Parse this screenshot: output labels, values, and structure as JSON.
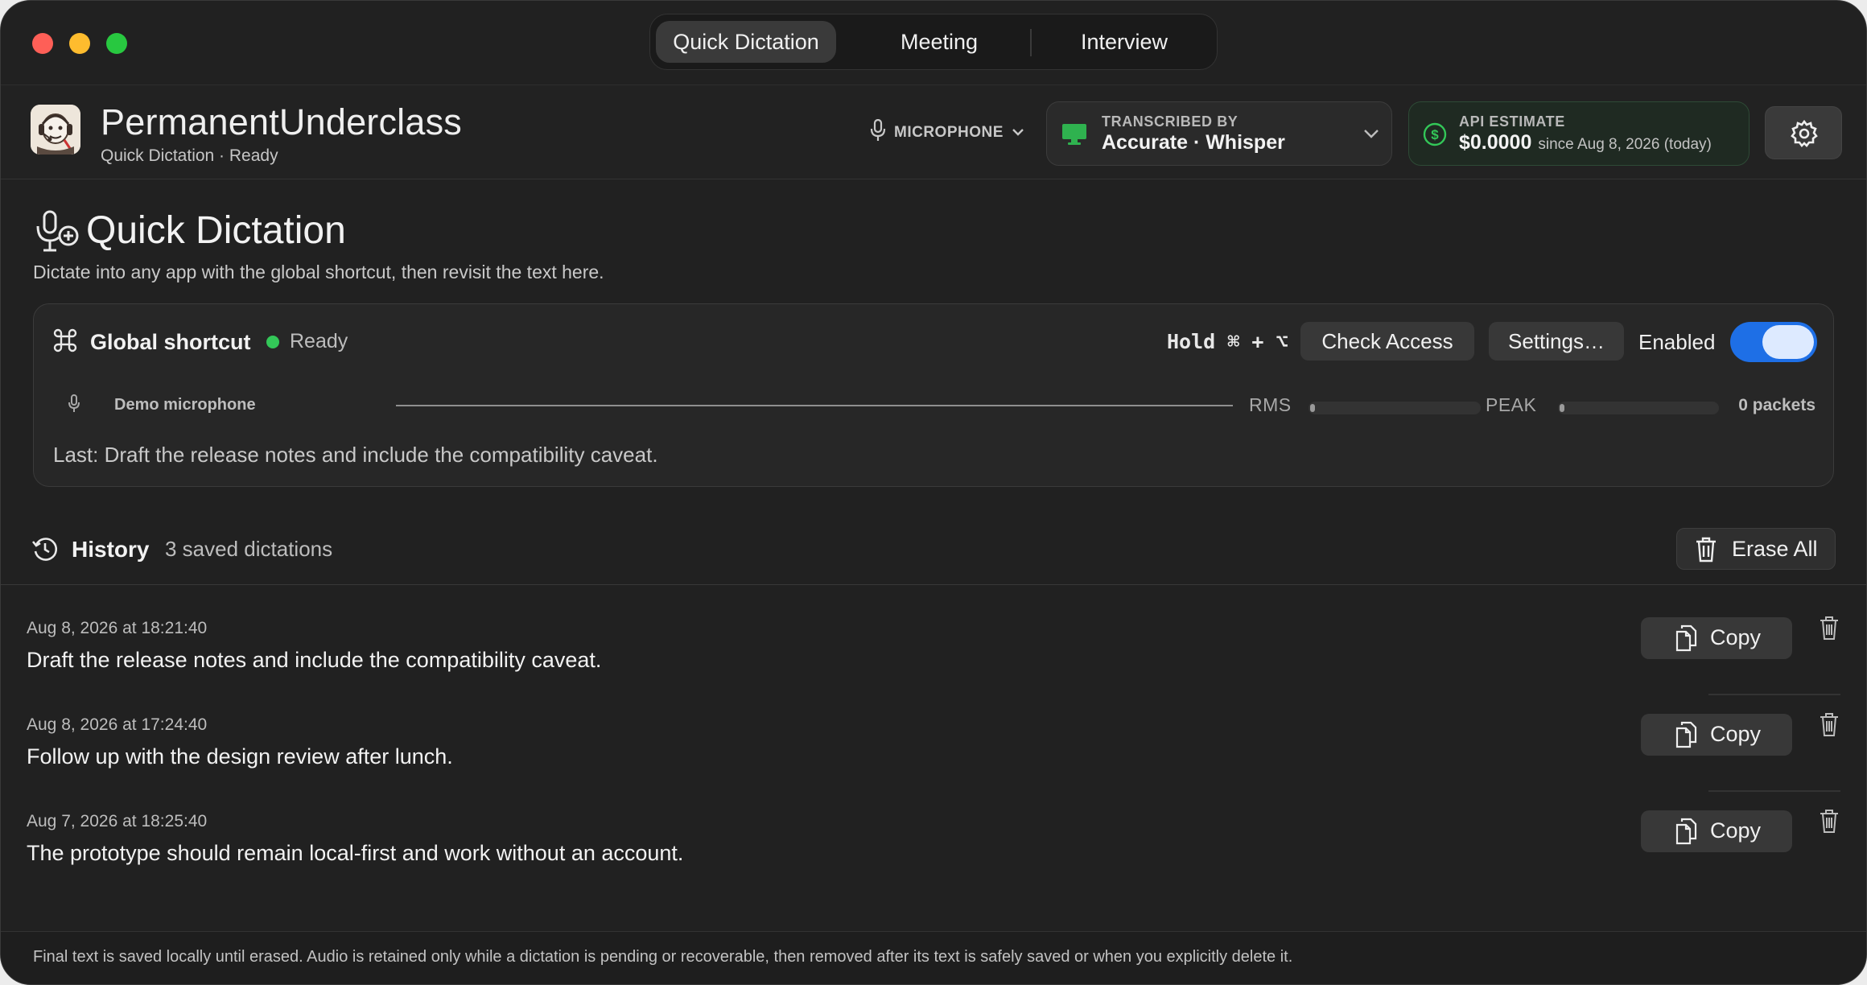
{
  "window": {
    "tabs": [
      {
        "label": "Quick Dictation",
        "active": true
      },
      {
        "label": "Meeting",
        "active": false
      },
      {
        "label": "Interview",
        "active": false
      }
    ]
  },
  "header": {
    "app_name": "PermanentUnderclass",
    "subtitle": "Quick Dictation · Ready",
    "microphone_label": "MICROPHONE",
    "transcription": {
      "label": "TRANSCRIBED BY",
      "value": "Accurate · Whisper"
    },
    "api": {
      "label": "API ESTIMATE",
      "value": "$0.0000",
      "since": "since Aug 8, 2026 (today)"
    },
    "colors": {
      "accent_green": "#33c758",
      "toggle_blue": "#1e6fe6"
    }
  },
  "section": {
    "title": "Quick Dictation",
    "description": "Dictate into any app with the global shortcut, then revisit the text here."
  },
  "shortcut_card": {
    "title": "Global shortcut",
    "status": "Ready",
    "hold_text": "Hold ⌘ + ⌥",
    "check_access": "Check Access",
    "settings": "Settings…",
    "enabled_label": "Enabled",
    "enabled": true,
    "microphone_name": "Demo microphone",
    "rms_label": "RMS",
    "peak_label": "PEAK",
    "rms_level": 0,
    "peak_level": 0,
    "packets": "0 packets",
    "last": "Last: Draft the release notes and include the compatibility caveat."
  },
  "history": {
    "title": "History",
    "count": "3 saved dictations",
    "erase_label": "Erase All",
    "copy_label": "Copy",
    "entries": [
      {
        "time": "Aug 8, 2026 at 18:21:40",
        "text": "Draft the release notes and include the compatibility caveat."
      },
      {
        "time": "Aug 8, 2026 at 17:24:40",
        "text": "Follow up with the design review after lunch."
      },
      {
        "time": "Aug 7, 2026 at 18:25:40",
        "text": "The prototype should remain local-first and work without an account."
      }
    ]
  },
  "footer": {
    "text": "Final text is saved locally until erased. Audio is retained only while a dictation is pending or recoverable, then removed after its text is safely saved or when you explicitly delete it."
  }
}
